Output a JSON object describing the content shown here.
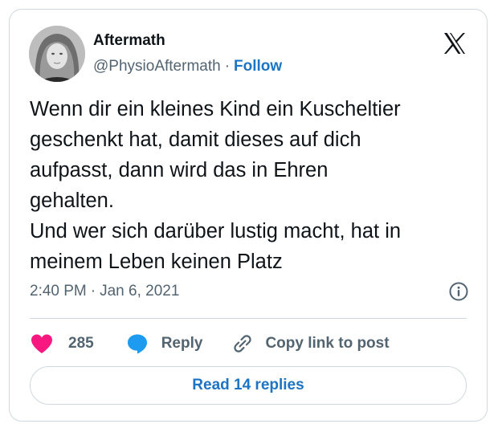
{
  "author": {
    "name": "Aftermath",
    "handle": "@PhysioAftermath",
    "separator": "·",
    "follow_label": "Follow"
  },
  "post": {
    "text": "Wenn dir ein kleines Kind ein Kuscheltier\ngeschenkt hat, damit dieses auf dich\naufpasst, dann wird das in Ehren\ngehalten.\nUnd wer sich darüber lustig macht, hat in\nmeinem Leben keinen Platz",
    "time": "2:40 PM",
    "separator": "·",
    "date": "Jan 6, 2021"
  },
  "actions": {
    "like_count": "285",
    "reply_label": "Reply",
    "copy_label": "Copy link to post"
  },
  "read_replies_label": "Read 14 replies",
  "icons": {
    "platform": "x-logo-icon",
    "info": "info-icon",
    "like": "heart-icon",
    "reply": "speech-bubble-icon",
    "copy": "link-icon"
  },
  "colors": {
    "heart": "#f91880",
    "reply_bubble": "#1d9bf0",
    "link_blue": "#1d73c4",
    "muted_text": "#536471"
  }
}
